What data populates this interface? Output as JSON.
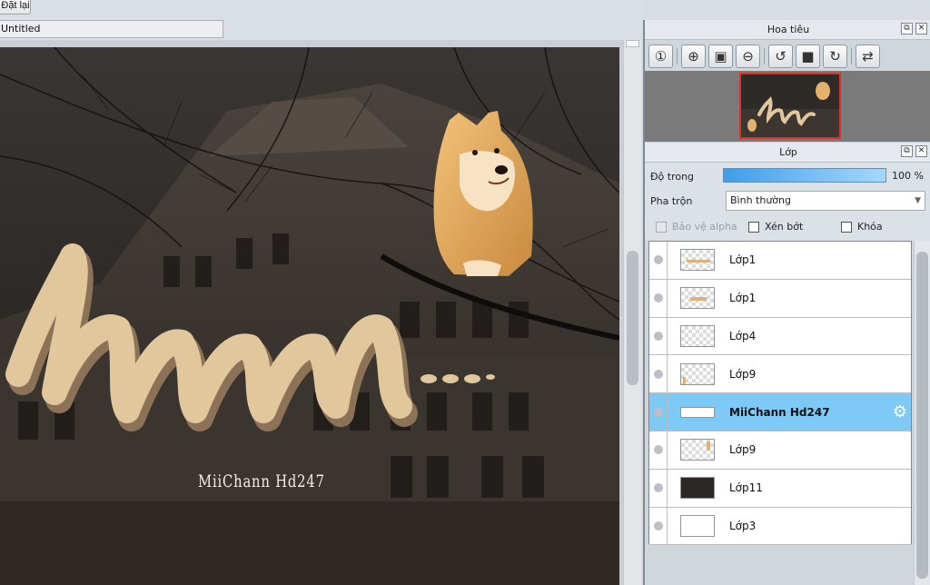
{
  "toolbar": {
    "reset_label": "Đặt lại",
    "document_name": "Untitled"
  },
  "canvas": {
    "watermark": "MiiChann Hd247",
    "hand_text": "hmm..."
  },
  "navigator": {
    "title": "Hoa tiêu",
    "tools": [
      {
        "icon": "zoom-actual-icon",
        "glyph": "①"
      },
      {
        "icon": "zoom-in-icon",
        "glyph": "⊕"
      },
      {
        "icon": "fit-window-icon",
        "glyph": "▣"
      },
      {
        "icon": "zoom-out-icon",
        "glyph": "⊖"
      },
      {
        "icon": "rotate-left-icon",
        "glyph": "↺"
      },
      {
        "icon": "fit-screen-icon",
        "glyph": "■"
      },
      {
        "icon": "rotate-right-icon",
        "glyph": "↻"
      },
      {
        "icon": "flip-horizontal-icon",
        "glyph": "⇄"
      }
    ]
  },
  "layers_panel": {
    "title": "Lớp",
    "opacity_label": "Độ trong",
    "opacity_value": "100 %",
    "opacity": 1.0,
    "blend_label": "Pha trộn",
    "blend_value": "Bình thường",
    "protect_alpha": "Bảo vệ alpha",
    "clipping": "Xén bớt",
    "lock": "Khóa",
    "layers": [
      {
        "name": "Lớp1",
        "selected": false
      },
      {
        "name": "Lớp1",
        "selected": false
      },
      {
        "name": "Lớp4",
        "selected": false
      },
      {
        "name": "Lớp9",
        "selected": false
      },
      {
        "name": "MiiChann Hd247",
        "selected": true
      },
      {
        "name": "Lớp9",
        "selected": false
      },
      {
        "name": "Lớp11",
        "selected": false
      },
      {
        "name": "Lớp3",
        "selected": false
      }
    ]
  },
  "colors": {
    "accent": "#7ccaf5",
    "navigator_frame": "#e0302a"
  }
}
